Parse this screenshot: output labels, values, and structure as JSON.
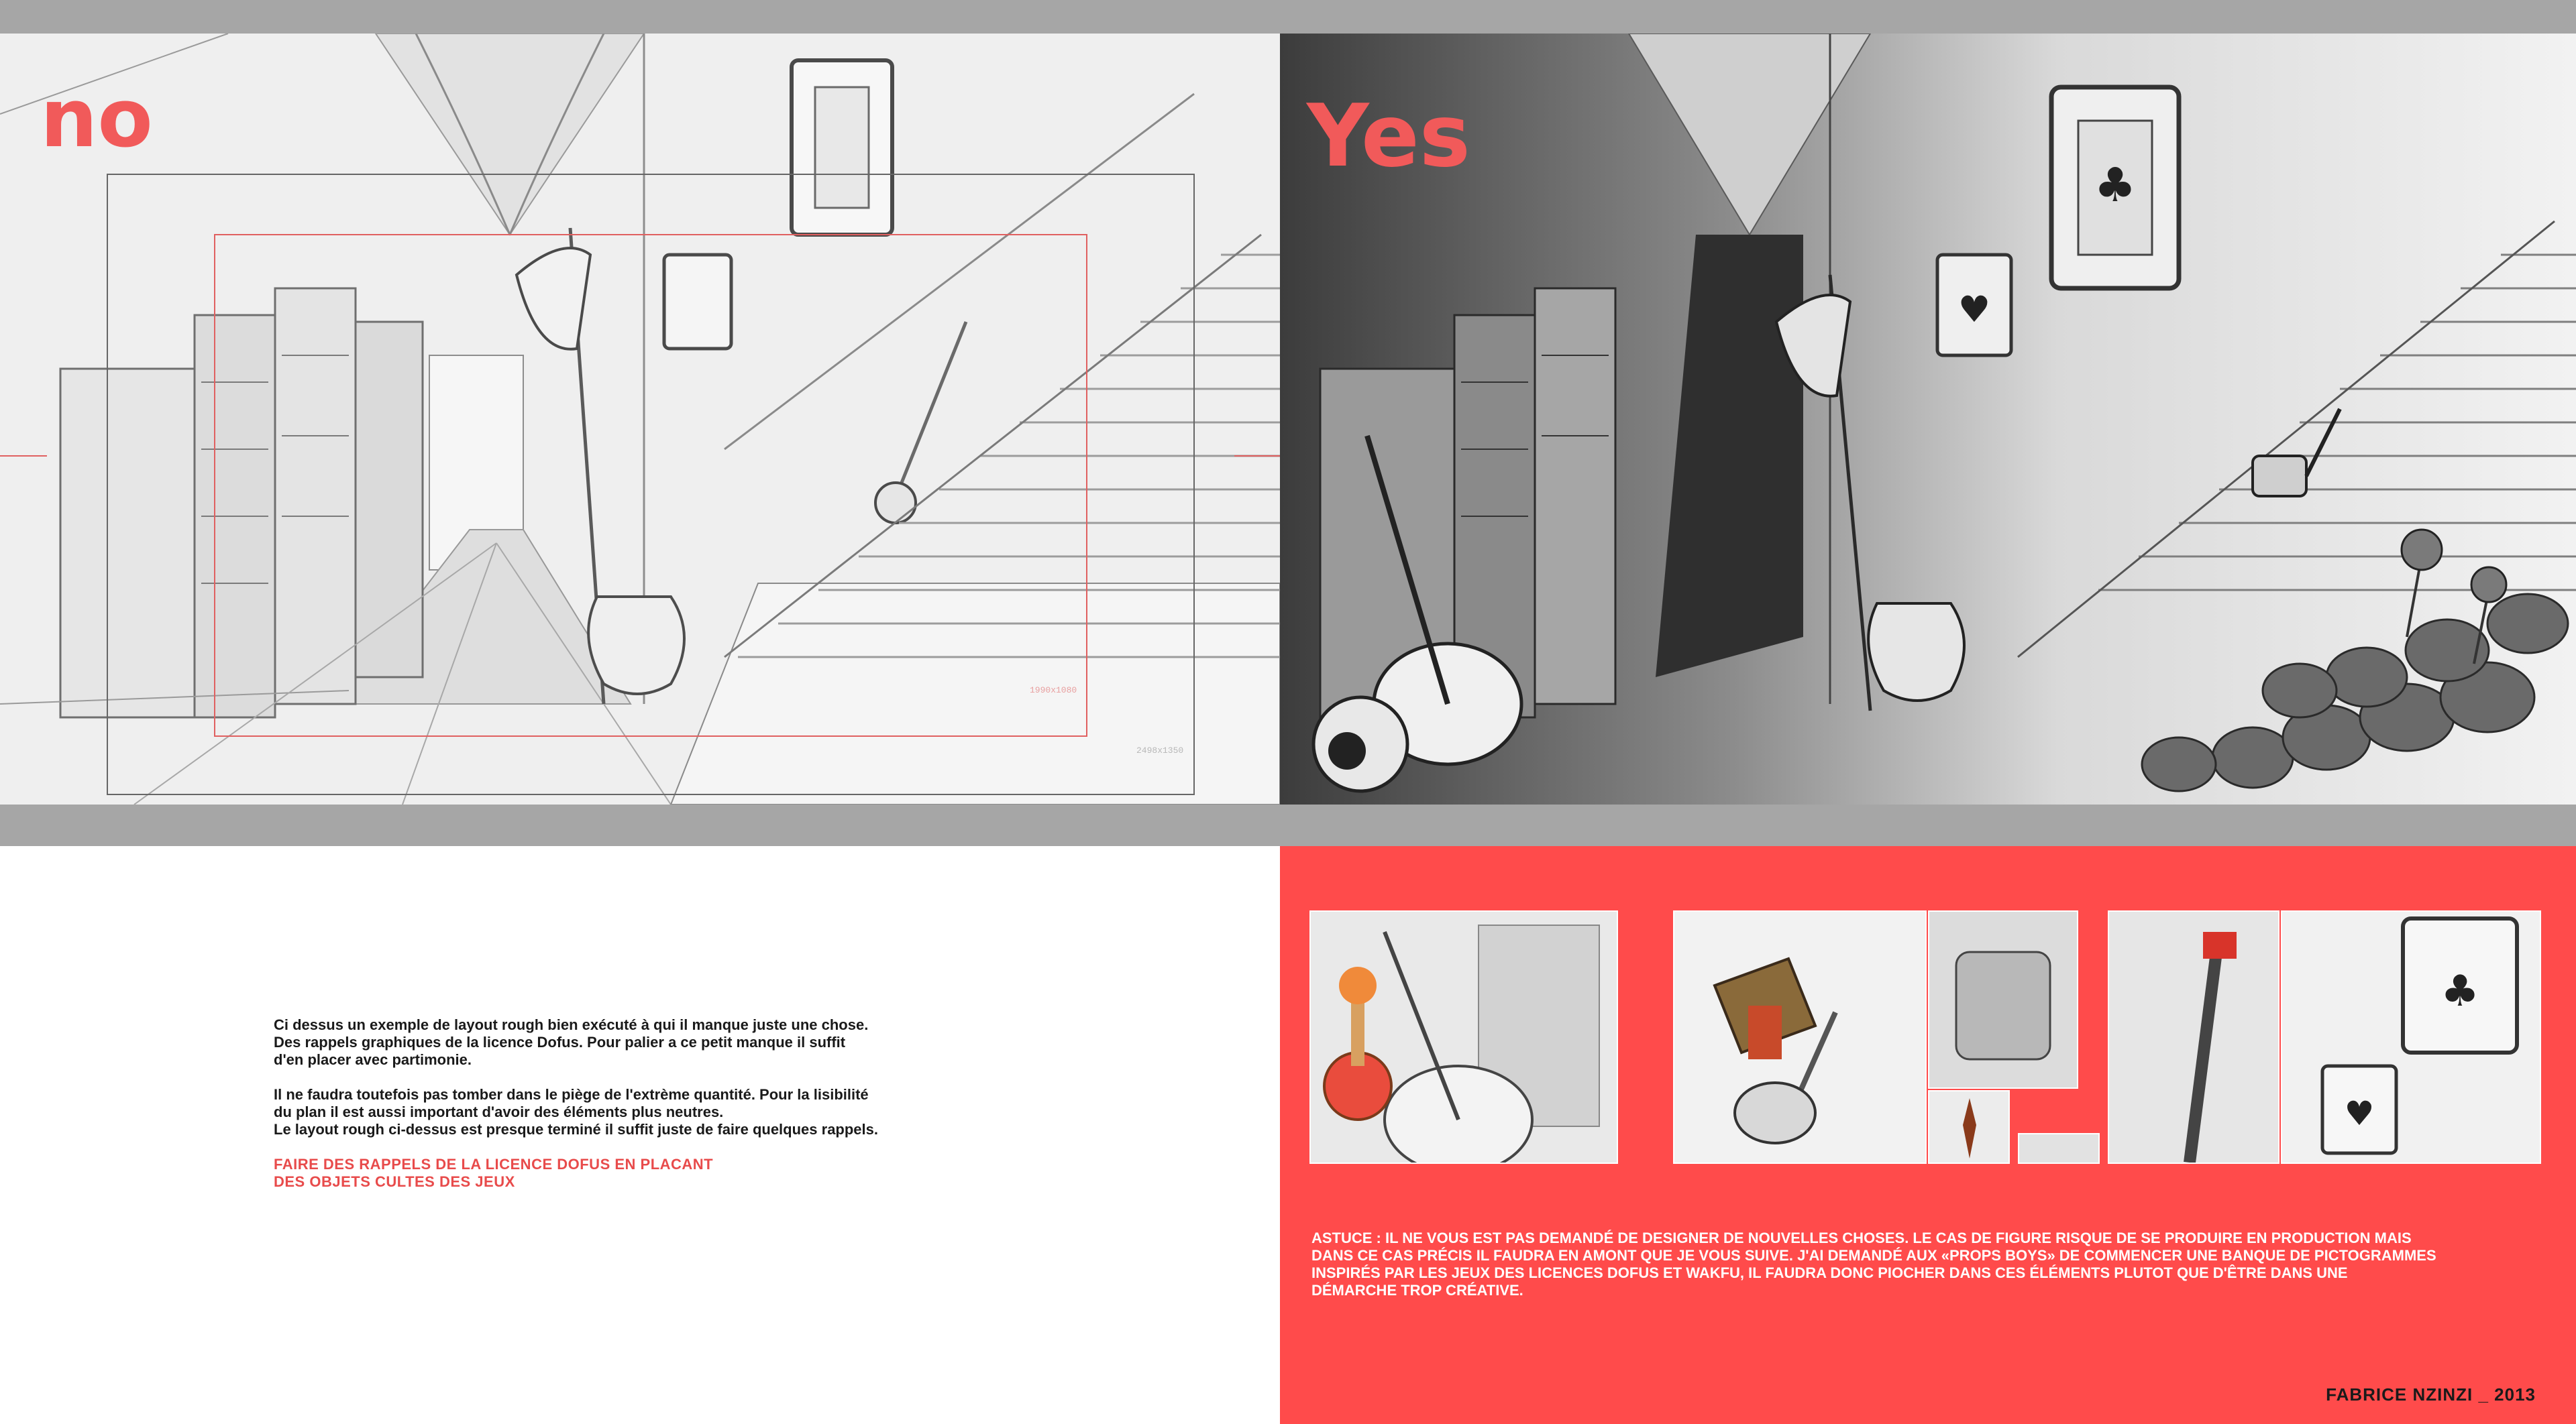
{
  "labels": {
    "no": "no",
    "yes": "Yes"
  },
  "frames": {
    "outer": "2498x1350",
    "inner": "1990x1080"
  },
  "text_block": {
    "p1_lines": [
      "Ci dessus un exemple de layout rough bien exécuté à qui il manque juste une chose.",
      "Des rappels graphiques de la licence Dofus. Pour palier a ce petit manque il suffit",
      "d'en placer avec partimonie."
    ],
    "p2_lines": [
      "Il ne faudra toutefois pas tomber dans le piège de l'extrème quantité. Pour la lisibilité",
      "du plan il est aussi important d'avoir des éléments plus neutres.",
      "Le layout rough ci-dessus est presque terminé il suffit juste de faire quelques rappels."
    ],
    "note_lines": [
      "FAIRE DES RAPPELS DE LA LICENCE DOFUS EN PLACANT",
      "DES OBJETS CULTES DES JEUX"
    ]
  },
  "astuce_lines": [
    "ASTUCE : IL NE VOUS EST PAS DEMANDÉ DE DESIGNER DE NOUVELLES CHOSES. LE CAS DE FIGURE RISQUE DE SE PRODUIRE EN PRODUCTION MAIS",
    "DANS CE CAS PRÉCIS IL FAUDRA EN AMONT QUE JE VOUS SUIVE. J'AI DEMANDÉ AUX «PROPS BOYS» DE COMMENCER UNE BANQUE DE PICTOGRAMMES",
    "INSPIRÉS PAR LES JEUX DES LICENCES DOFUS ET WAKFU, IL FAUDRA DONC PIOCHER DANS CES ÉLÉMENTS PLUTOT QUE D'ÊTRE DANS UNE",
    "DÉMARCHE TROP CRÉATIVE."
  ],
  "credit": "FABRICE NZINZI _ 2013",
  "colors": {
    "accent_red": "#ff4b4b",
    "label_red": "#f15a5a",
    "gray_bar": "#a6a6a6"
  }
}
